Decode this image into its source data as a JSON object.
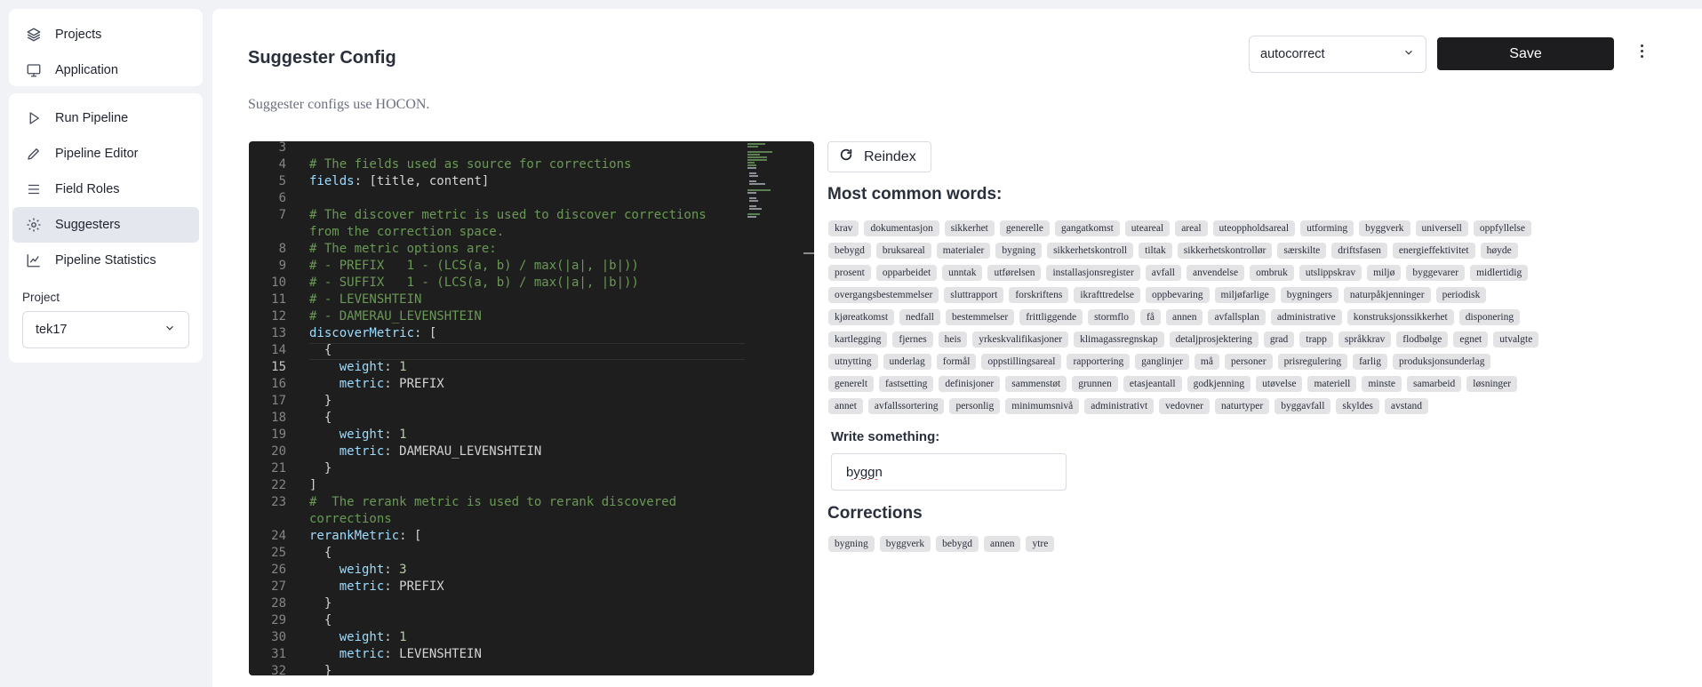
{
  "sidebar": {
    "top_items": [
      {
        "label": "Projects",
        "icon": "layers-icon"
      },
      {
        "label": "Application",
        "icon": "monitor-icon"
      }
    ],
    "items": [
      {
        "label": "Run Pipeline",
        "icon": "play-icon"
      },
      {
        "label": "Pipeline Editor",
        "icon": "pencil-icon"
      },
      {
        "label": "Field Roles",
        "icon": "list-icon"
      },
      {
        "label": "Suggesters",
        "icon": "gear-icon",
        "active": true
      },
      {
        "label": "Pipeline Statistics",
        "icon": "chart-icon"
      }
    ],
    "project_label": "Project",
    "project_value": "tek17"
  },
  "header": {
    "title": "Suggester Config",
    "subtitle": "Suggester configs use HOCON.",
    "suggester_select": "autocorrect",
    "save_label": "Save"
  },
  "editor": {
    "lines": [
      {
        "n": "3",
        "text": ""
      },
      {
        "n": "4",
        "text": "# The fields used as source for corrections"
      },
      {
        "n": "5",
        "text": "fields: [title, content]"
      },
      {
        "n": "6",
        "text": ""
      },
      {
        "n": "7",
        "text": "# The discover metric is used to discover corrections"
      },
      {
        "n": "",
        "text": "from the correction space."
      },
      {
        "n": "8",
        "text": "# The metric options are:"
      },
      {
        "n": "9",
        "text": "# - PREFIX   1 - (LCS(a, b) / max(|a|, |b|))"
      },
      {
        "n": "10",
        "text": "# - SUFFIX   1 - (LCS(a, b) / max(|a|, |b|))"
      },
      {
        "n": "11",
        "text": "# - LEVENSHTEIN"
      },
      {
        "n": "12",
        "text": "# - DAMERAU_LEVENSHTEIN"
      },
      {
        "n": "13",
        "text": "discoverMetric: ["
      },
      {
        "n": "14",
        "text": "  {"
      },
      {
        "n": "15",
        "text": "    weight: 1"
      },
      {
        "n": "16",
        "text": "    metric: PREFIX"
      },
      {
        "n": "17",
        "text": "  }"
      },
      {
        "n": "18",
        "text": "  {"
      },
      {
        "n": "19",
        "text": "    weight: 1"
      },
      {
        "n": "20",
        "text": "    metric: DAMERAU_LEVENSHTEIN"
      },
      {
        "n": "21",
        "text": "  }"
      },
      {
        "n": "22",
        "text": "]"
      },
      {
        "n": "23",
        "text": "#  The rerank metric is used to rerank discovered"
      },
      {
        "n": "",
        "text": "corrections"
      },
      {
        "n": "24",
        "text": "rerankMetric: ["
      },
      {
        "n": "25",
        "text": "  {"
      },
      {
        "n": "26",
        "text": "    weight: 3"
      },
      {
        "n": "27",
        "text": "    metric: PREFIX"
      },
      {
        "n": "28",
        "text": "  }"
      },
      {
        "n": "29",
        "text": "  {"
      },
      {
        "n": "30",
        "text": "    weight: 1"
      },
      {
        "n": "31",
        "text": "    metric: LEVENSHTEIN"
      },
      {
        "n": "32",
        "text": "  }"
      }
    ]
  },
  "reindex": {
    "label": "Reindex"
  },
  "common_words": {
    "heading": "Most common words:",
    "words": [
      "krav",
      "dokumentasjon",
      "sikkerhet",
      "generelle",
      "gangatkomst",
      "uteareal",
      "areal",
      "uteoppholdsareal",
      "utforming",
      "byggverk",
      "universell",
      "oppfyllelse",
      "bebygd",
      "bruksareal",
      "materialer",
      "bygning",
      "sikkerhetskontroll",
      "tiltak",
      "sikkerhetskontrollør",
      "særskilte",
      "driftsfasen",
      "energieffektivitet",
      "høyde",
      "prosent",
      "opparbeidet",
      "unntak",
      "utførelsen",
      "installasjonsregister",
      "avfall",
      "anvendelse",
      "ombruk",
      "utslippskrav",
      "miljø",
      "byggevarer",
      "midlertidig",
      "overgangsbestemmelser",
      "sluttrapport",
      "forskriftens",
      "ikrafttredelse",
      "oppbevaring",
      "miljøfarlige",
      "bygningers",
      "naturpåkjenninger",
      "periodisk",
      "kjøreatkomst",
      "nedfall",
      "bestemmelser",
      "frittliggende",
      "stormflo",
      "få",
      "annen",
      "avfallsplan",
      "administrative",
      "konstruksjonssikkerhet",
      "disponering",
      "kartlegging",
      "fjernes",
      "heis",
      "yrkeskvalifikasjoner",
      "klimagassregnskap",
      "detaljprosjektering",
      "grad",
      "trapp",
      "språkkrav",
      "flodbølge",
      "egnet",
      "utvalgte",
      "utnytting",
      "underlag",
      "formål",
      "oppstillingsareal",
      "rapportering",
      "ganglinjer",
      "må",
      "personer",
      "prisregulering",
      "farlig",
      "produksjonsunderlag",
      "generelt",
      "fastsetting",
      "definisjoner",
      "sammenstøt",
      "grunnen",
      "etasjeantall",
      "godkjenning",
      "utøvelse",
      "materiell",
      "minste",
      "samarbeid",
      "løsninger",
      "annet",
      "avfallssortering",
      "personlig",
      "minimumsnivå",
      "administrativt",
      "vedovner",
      "naturtyper",
      "byggavfall",
      "skyldes",
      "avstand"
    ]
  },
  "write": {
    "heading": "Write something:",
    "value": "byggn"
  },
  "corrections": {
    "heading": "Corrections",
    "words": [
      "bygning",
      "byggverk",
      "bebygd",
      "annen",
      "ytre"
    ]
  }
}
